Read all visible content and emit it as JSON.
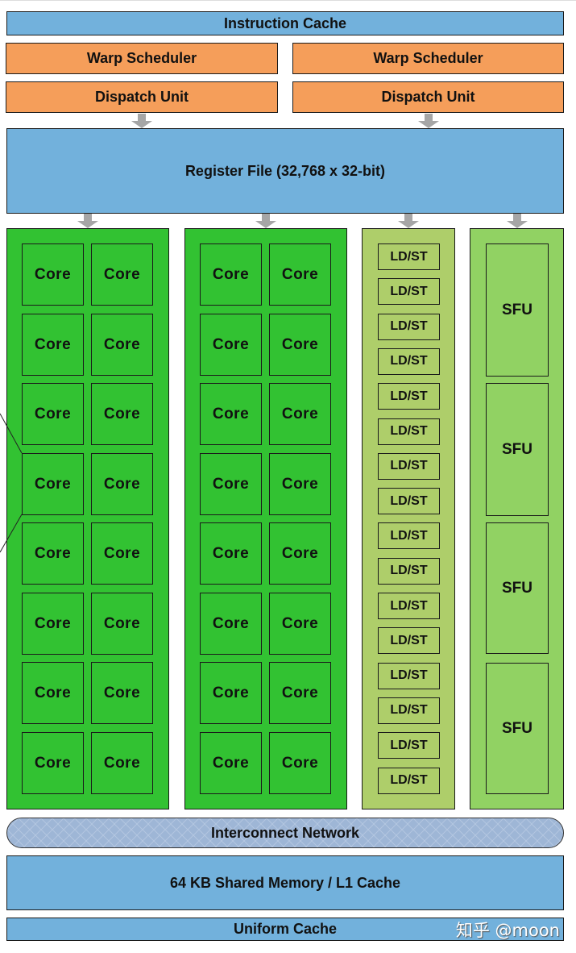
{
  "diagram": {
    "instruction_cache": "Instruction Cache",
    "warp_schedulers": [
      "Warp Scheduler",
      "Warp Scheduler"
    ],
    "dispatch_units": [
      "Dispatch Unit",
      "Dispatch Unit"
    ],
    "register_file": "Register File (32,768 x 32-bit)",
    "core_label": "Core",
    "core_columns": 2,
    "cores_per_column": 16,
    "ldst_label": "LD/ST",
    "ldst_count": 16,
    "sfu_label": "SFU",
    "sfu_count": 4,
    "interconnect": "Interconnect Network",
    "shared_memory": "64 KB Shared Memory / L1 Cache",
    "uniform_cache": "Uniform Cache",
    "watermark": "知乎 @moon"
  },
  "colors": {
    "cache_blue": "#72b1dc",
    "scheduler_orange": "#f59e5a",
    "core_green": "#32c232",
    "ldst_green": "#aece6a",
    "sfu_green": "#91d263",
    "arrow_gray": "#a6a6a6"
  }
}
